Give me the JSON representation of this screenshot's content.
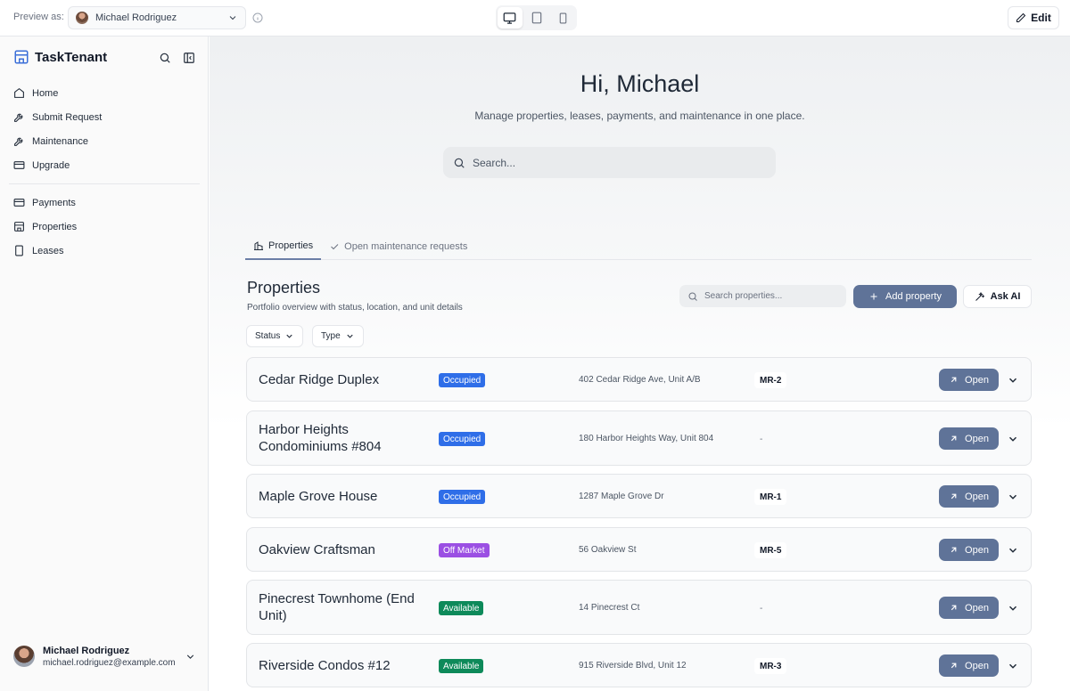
{
  "topbar": {
    "preview_label": "Preview as:",
    "selected_user": "Michael Rodriguez",
    "edit_label": "Edit"
  },
  "sidebar": {
    "brand": "TaskTenant",
    "nav_primary": [
      {
        "label": "Home",
        "icon": "home-icon"
      },
      {
        "label": "Submit Request",
        "icon": "wrench-icon"
      },
      {
        "label": "Maintenance",
        "icon": "wrench-icon"
      },
      {
        "label": "Upgrade",
        "icon": "credit-card-icon"
      }
    ],
    "nav_secondary": [
      {
        "label": "Payments",
        "icon": "credit-card-icon"
      },
      {
        "label": "Properties",
        "icon": "building-icon"
      },
      {
        "label": "Leases",
        "icon": "document-icon"
      }
    ],
    "user": {
      "name": "Michael Rodriguez",
      "email": "michael.rodriguez@example.com"
    }
  },
  "hero": {
    "greeting": "Hi, Michael",
    "subtitle": "Manage properties, leases, payments, and maintenance in one place.",
    "search_placeholder": "Search..."
  },
  "tabs": [
    {
      "label": "Properties",
      "active": true
    },
    {
      "label": "Open maintenance requests",
      "active": false
    }
  ],
  "properties_section": {
    "title": "Properties",
    "subtitle": "Portfolio overview with status, location, and unit details",
    "search_placeholder": "Search properties...",
    "add_label": "Add property",
    "ask_ai_label": "Ask AI",
    "filters": [
      "Status",
      "Type"
    ],
    "open_label": "Open"
  },
  "properties": [
    {
      "name": "Cedar Ridge Duplex",
      "status": "Occupied",
      "status_kind": "occupied",
      "address": "402 Cedar Ridge Ave, Unit A/B",
      "unit": "MR-2"
    },
    {
      "name": "Harbor Heights Condominiums #804",
      "status": "Occupied",
      "status_kind": "occupied",
      "address": "180 Harbor Heights Way, Unit 804",
      "unit": "-"
    },
    {
      "name": "Maple Grove House",
      "status": "Occupied",
      "status_kind": "occupied",
      "address": "1287 Maple Grove Dr",
      "unit": "MR-1"
    },
    {
      "name": "Oakview Craftsman",
      "status": "Off Market",
      "status_kind": "offmarket",
      "address": "56 Oakview St",
      "unit": "MR-5"
    },
    {
      "name": "Pinecrest Townhome (End Unit)",
      "status": "Available",
      "status_kind": "available",
      "address": "14 Pinecrest Ct",
      "unit": "-"
    },
    {
      "name": "Riverside Condos #12",
      "status": "Available",
      "status_kind": "available",
      "address": "915 Riverside Blvd, Unit 12",
      "unit": "MR-3"
    }
  ],
  "colors": {
    "primary_button": "#5f7398",
    "occupied": "#2f6ee8",
    "off_market": "#9b4fe3",
    "available": "#0e8a5a"
  }
}
